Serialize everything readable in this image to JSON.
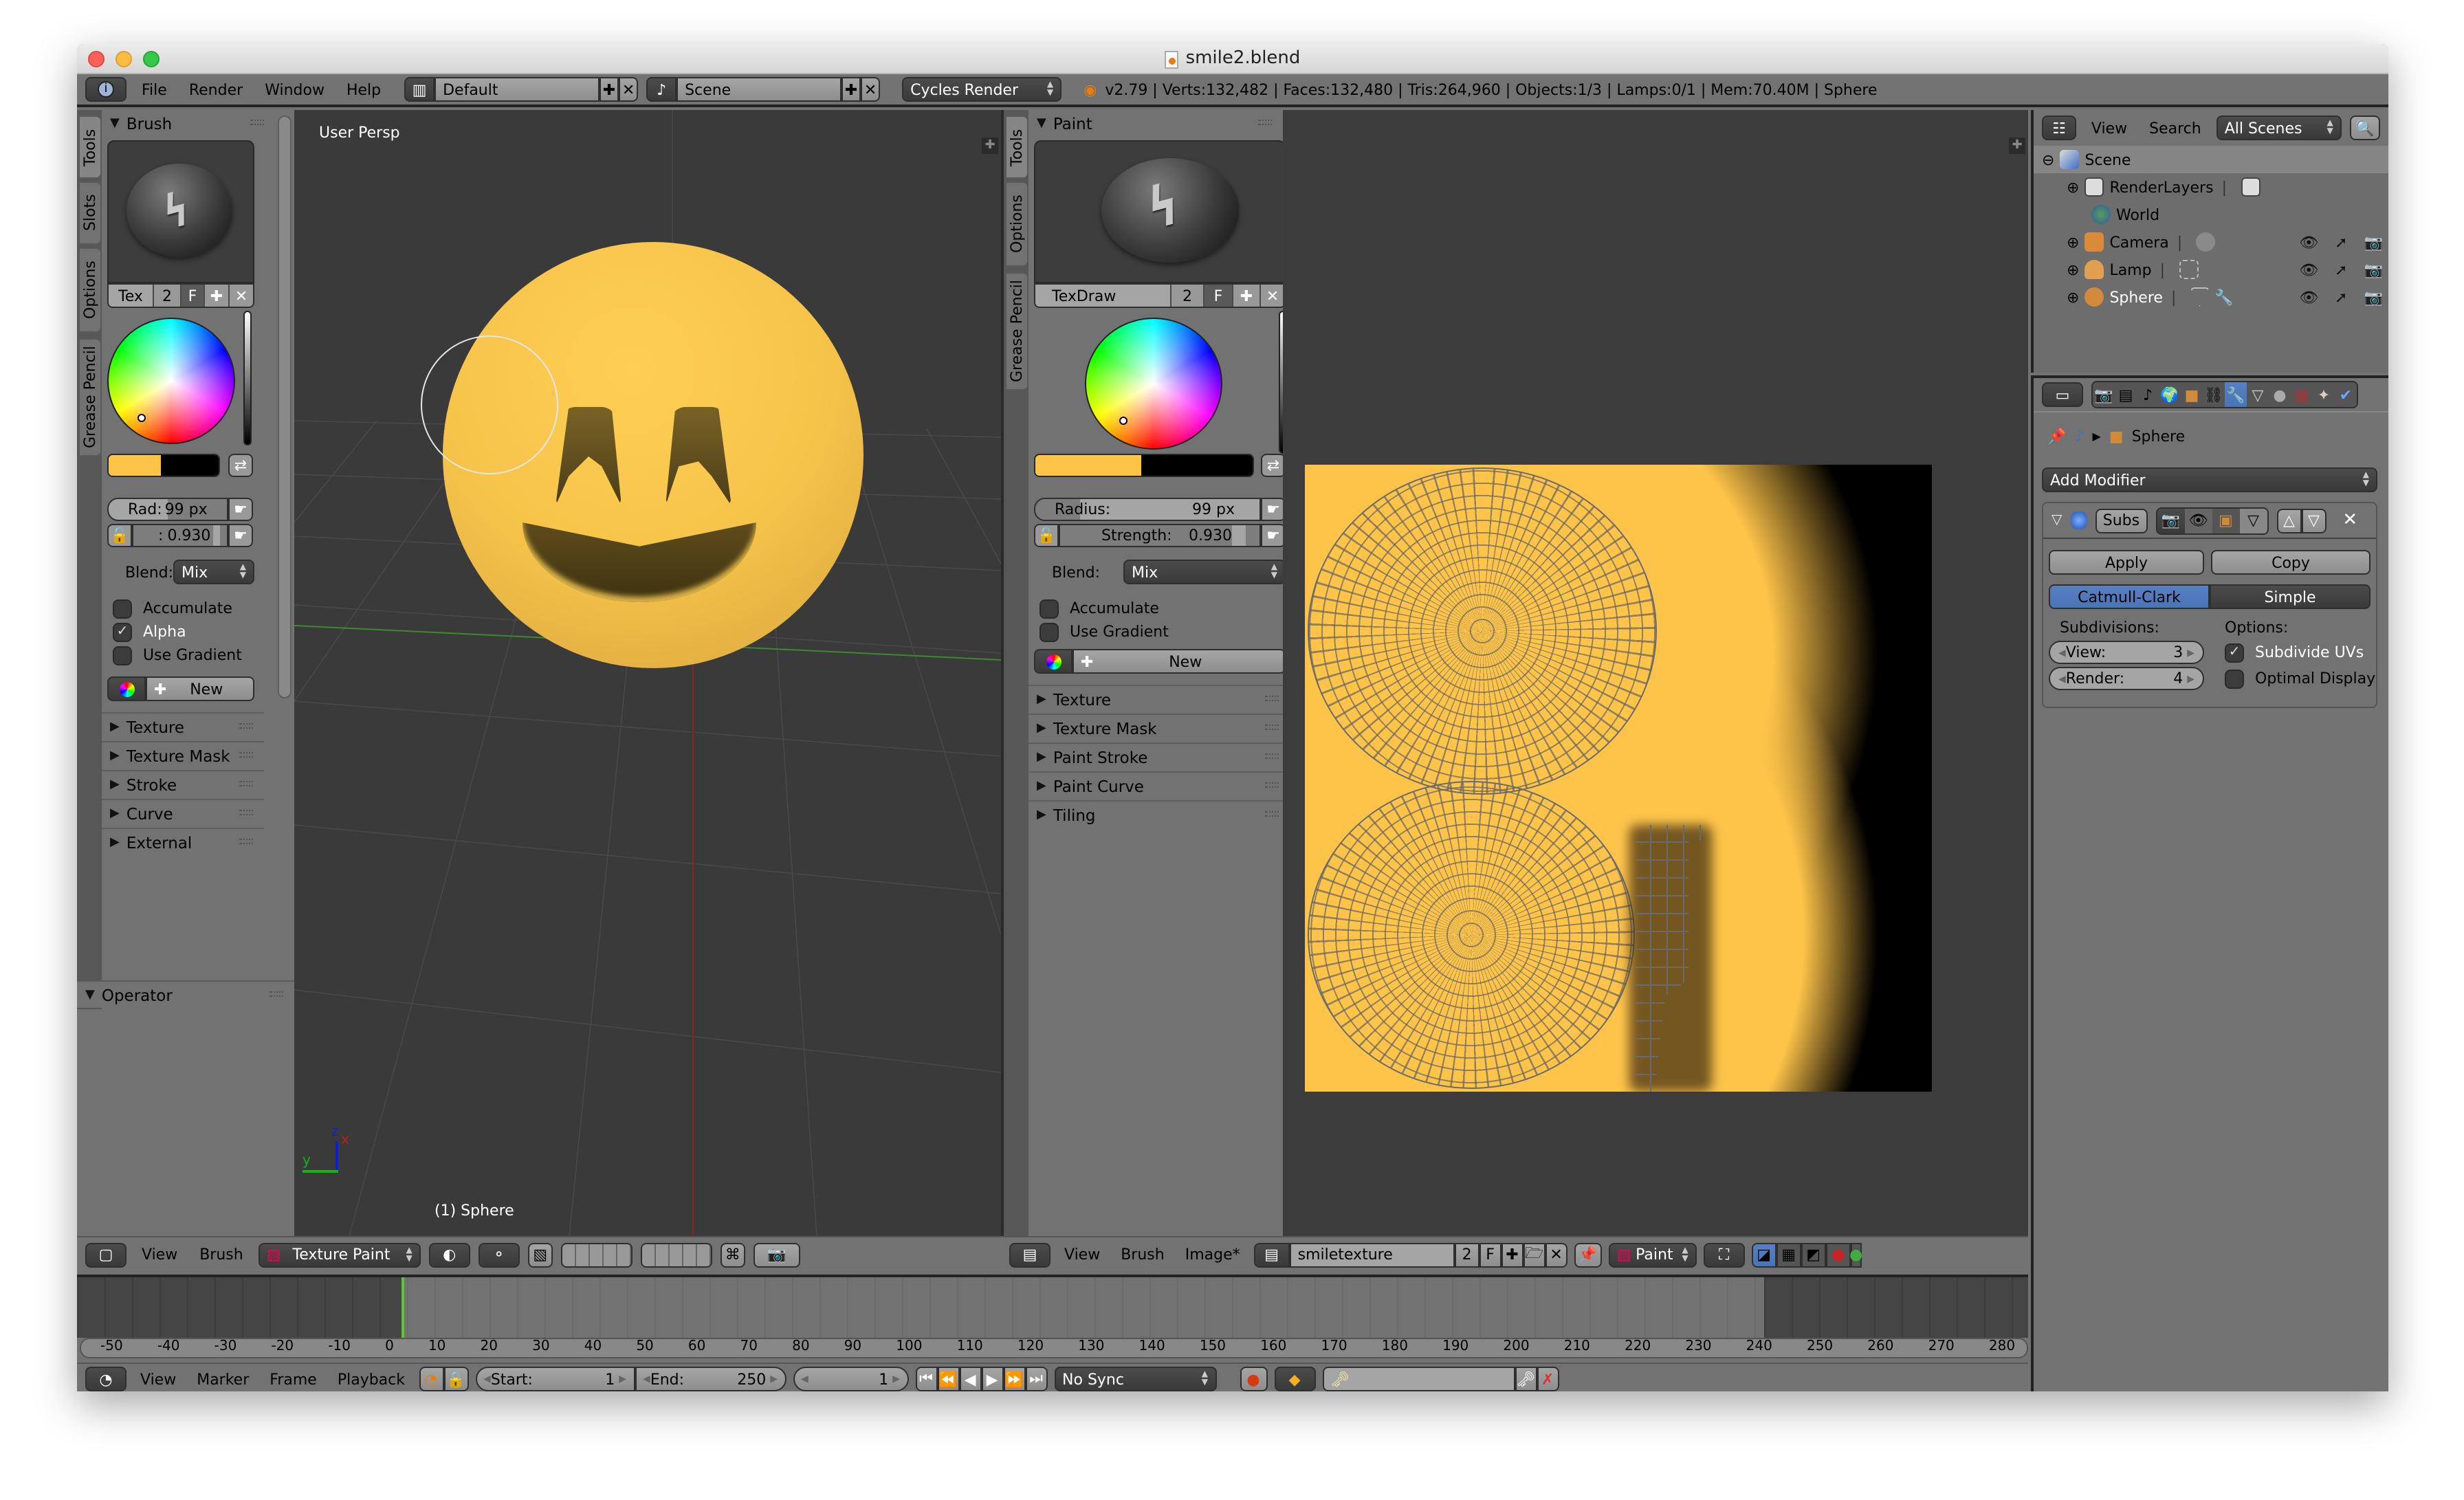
{
  "window": {
    "title": "smile2.blend",
    "traffic_lights": [
      "close",
      "minimize",
      "zoom"
    ]
  },
  "info_header": {
    "menus": [
      "File",
      "Render",
      "Window",
      "Help"
    ],
    "screen_layout": "Default",
    "scene": "Scene",
    "render_engine": "Cycles Render",
    "stats": "v2.79 | Verts:132,482 | Faces:132,480 | Tris:264,960 | Objects:1/3 | Lamps:0/1 | Mem:70.40M | Sphere"
  },
  "left_toolshelf": {
    "tabs": [
      "Tools",
      "Slots",
      "Options",
      "Grease Pencil"
    ],
    "active_tab": "Tools",
    "brush_panel": {
      "title": "Brush",
      "brush_name": "Tex",
      "users": "2",
      "fake_user": "F",
      "radius_label": "Rad:",
      "radius_value": "99 px",
      "strength_label": ":",
      "strength_value": "0.930",
      "strength_fraction": 0.93,
      "blend_label": "Blend:",
      "blend_value": "Mix",
      "checkboxes": [
        {
          "label": "Accumulate",
          "checked": false
        },
        {
          "label": "Alpha",
          "checked": true
        },
        {
          "label": "Use Gradient",
          "checked": false
        }
      ],
      "palette_new": "New",
      "primary_color": "#fec44a",
      "secondary_color": "#000000"
    },
    "collapsed_panels": [
      "Texture",
      "Texture Mask",
      "Stroke",
      "Curve",
      "External"
    ],
    "operator_title": "Operator"
  },
  "viewport3d": {
    "view_label": "User Persp",
    "object_label": "(1) Sphere",
    "axes": {
      "x": "x",
      "y": "y",
      "z": "z"
    },
    "header": {
      "menus": [
        "View",
        "Brush"
      ],
      "mode": "Texture Paint"
    }
  },
  "image_toolshelf": {
    "tabs": [
      "Tools",
      "Options",
      "Grease Pencil"
    ],
    "active_tab": "Tools",
    "paint_panel": {
      "title": "Paint",
      "brush_name": "TexDraw",
      "users": "2",
      "fake_user": "F",
      "radius_label": "Radius:",
      "radius_value": "99 px",
      "strength_label": "Strength:",
      "strength_value": "0.930",
      "strength_fraction": 0.93,
      "blend_label": "Blend:",
      "blend_value": "Mix",
      "checkboxes": [
        {
          "label": "Accumulate",
          "checked": false
        },
        {
          "label": "Use Gradient",
          "checked": false
        }
      ],
      "palette_new": "New",
      "primary_color": "#fec44a",
      "secondary_color": "#000000"
    },
    "collapsed_panels": [
      "Texture",
      "Texture Mask",
      "Paint Stroke",
      "Paint Curve",
      "Tiling"
    ]
  },
  "image_editor": {
    "header": {
      "menus": [
        "View",
        "Brush",
        "Image*"
      ],
      "image_name": "smiletexture",
      "users": "2",
      "fake_user": "F",
      "mode": "Paint"
    }
  },
  "outliner": {
    "menus": [
      "View",
      "Search"
    ],
    "display_mode": "All Scenes",
    "items": [
      {
        "name": "Scene",
        "level": 0,
        "icon": "scene-icon",
        "expander": "minus"
      },
      {
        "name": "RenderLayers",
        "level": 1,
        "icon": "renderlayers-icon",
        "expander": "plus"
      },
      {
        "name": "World",
        "level": 1,
        "icon": "world-icon",
        "expander": ""
      },
      {
        "name": "Camera",
        "level": 1,
        "icon": "camera-icon",
        "expander": "plus",
        "visibility": true
      },
      {
        "name": "Lamp",
        "level": 1,
        "icon": "lamp-icon",
        "expander": "plus",
        "visibility": true
      },
      {
        "name": "Sphere",
        "level": 1,
        "icon": "mesh-icon",
        "expander": "plus",
        "visibility": true,
        "selected": true
      }
    ]
  },
  "properties": {
    "context_tabs": [
      "render",
      "render-layers",
      "scene",
      "world",
      "object",
      "constraints",
      "modifiers",
      "data",
      "material",
      "texture",
      "particles",
      "physics"
    ],
    "active_tab": "modifiers",
    "breadcrumb": "Sphere",
    "add_modifier": "Add Modifier",
    "modifier": {
      "name": "Subs",
      "apply": "Apply",
      "copy": "Copy",
      "algorithms": [
        "Catmull-Clark",
        "Simple"
      ],
      "active_algorithm": "Catmull-Clark",
      "subdivisions_label": "Subdivisions:",
      "view_label": "View:",
      "view_value": "3",
      "render_label": "Render:",
      "render_value": "4",
      "options_label": "Options:",
      "options": [
        {
          "label": "Subdivide UVs",
          "checked": true
        },
        {
          "label": "Optimal Display",
          "checked": false
        }
      ]
    }
  },
  "timeline": {
    "ruler_ticks": [
      "-50",
      "-40",
      "-30",
      "-20",
      "-10",
      "0",
      "10",
      "20",
      "30",
      "40",
      "50",
      "60",
      "70",
      "80",
      "90",
      "100",
      "110",
      "120",
      "130",
      "140",
      "150",
      "160",
      "170",
      "180",
      "190",
      "200",
      "210",
      "220",
      "230",
      "240",
      "250",
      "260",
      "270",
      "280"
    ],
    "current_frame_marker": "0",
    "header": {
      "menus": [
        "View",
        "Marker",
        "Frame",
        "Playback"
      ],
      "start_label": "Start:",
      "start_value": "1",
      "end_label": "End:",
      "end_value": "250",
      "current_frame": "1",
      "sync": "No Sync"
    }
  }
}
